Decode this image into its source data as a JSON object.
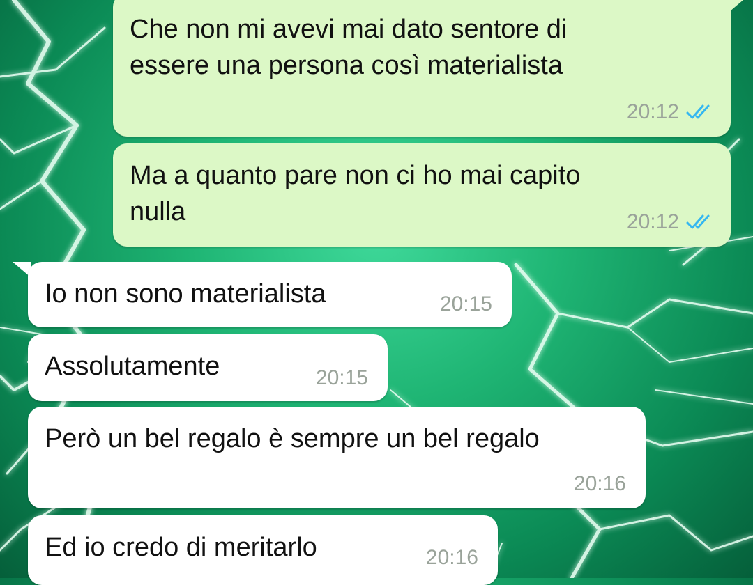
{
  "conversation": {
    "messages": [
      {
        "direction": "outgoing",
        "text": "Che non mi avevi mai dato sentore di\nessere una persona così materialista",
        "time": "20:12",
        "status": "read-double-check-icon"
      },
      {
        "direction": "outgoing",
        "text": "Ma a quanto pare non ci ho mai capito\nnulla",
        "time": "20:12",
        "status": "read-double-check-icon"
      },
      {
        "direction": "incoming",
        "text": "Io non sono materialista",
        "time": "20:15"
      },
      {
        "direction": "incoming",
        "text": "Assolutamente",
        "time": "20:15"
      },
      {
        "direction": "incoming",
        "text": "Però un bel regalo è sempre un bel regalo",
        "time": "20:16"
      },
      {
        "direction": "incoming",
        "text": "Ed io credo di meritarlo",
        "time": "20:16"
      }
    ]
  },
  "theme": {
    "outgoing_bubble": "#dcf8c6",
    "incoming_bubble": "#ffffff",
    "read_tick": "#34b7f1",
    "timestamp": "#9aa39a",
    "wallpaper": "#1fb574"
  }
}
